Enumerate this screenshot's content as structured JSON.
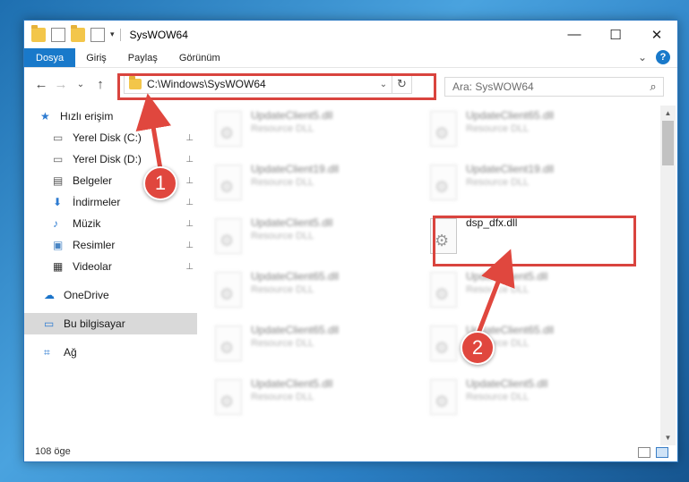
{
  "window": {
    "title": "SysWOW64",
    "minimize_glyph": "—",
    "maximize_glyph": "☐",
    "close_glyph": "✕"
  },
  "ribbon": {
    "tabs": [
      "Dosya",
      "Giriş",
      "Paylaş",
      "Görünüm"
    ],
    "collapse_glyph": "⌄",
    "help_glyph": "?"
  },
  "nav": {
    "back_glyph": "←",
    "forward_glyph": "→",
    "recent_glyph": "⌄",
    "up_glyph": "↑",
    "address": "C:\\Windows\\SysWOW64",
    "address_dropdown_glyph": "⌄",
    "refresh_glyph": "↻",
    "search_placeholder": "Ara: SysWOW64",
    "search_glyph": "⌕"
  },
  "sidebar": {
    "items": [
      {
        "label": "Hızlı erişim",
        "icon": "star-icon"
      },
      {
        "label": "Yerel Disk (C:)",
        "icon": "drive-icon",
        "pinned": true
      },
      {
        "label": "Yerel Disk (D:)",
        "icon": "drive-icon",
        "pinned": true
      },
      {
        "label": "Belgeler",
        "icon": "document-icon",
        "pinned": true
      },
      {
        "label": "İndirmeler",
        "icon": "download-icon",
        "pinned": true
      },
      {
        "label": "Müzik",
        "icon": "music-icon",
        "pinned": true
      },
      {
        "label": "Resimler",
        "icon": "pictures-icon",
        "pinned": true
      },
      {
        "label": "Videolar",
        "icon": "video-icon",
        "pinned": true
      },
      {
        "label": "OneDrive",
        "icon": "cloud-icon"
      },
      {
        "label": "Bu bilgisayar",
        "icon": "computer-icon",
        "selected": true
      },
      {
        "label": "Ağ",
        "icon": "network-icon"
      }
    ],
    "pin_glyph": "📌"
  },
  "files": [
    {
      "name": "UpdateClient5.dll",
      "type": "Resource DLL",
      "blurred": true
    },
    {
      "name": "UpdateClient65.dll",
      "type": "Resource DLL",
      "blurred": true
    },
    {
      "name": "UpdateClient19.dll",
      "type": "Resource DLL",
      "blurred": true
    },
    {
      "name": "UpdateClient19.dll",
      "type": "Resource DLL",
      "blurred": true
    },
    {
      "name": "UpdateClient5.dll",
      "type": "Resource DLL",
      "blurred": true
    },
    {
      "name": "dsp_dfx.dll",
      "type": "",
      "blurred": false
    },
    {
      "name": "UpdateClient65.dll",
      "type": "Resource DLL",
      "blurred": true
    },
    {
      "name": "UpdateClient5.dll",
      "type": "Resource DLL",
      "blurred": true
    },
    {
      "name": "UpdateClient65.dll",
      "type": "Resource DLL",
      "blurred": true
    },
    {
      "name": "UpdateClient65.dll",
      "type": "Resource DLL",
      "blurred": true
    },
    {
      "name": "UpdateClient5.dll",
      "type": "Resource DLL",
      "blurred": true
    },
    {
      "name": "UpdateClient5.dll",
      "type": "Resource DLL",
      "blurred": true
    }
  ],
  "status": {
    "item_count": "108 öge"
  },
  "callouts": {
    "one": "1",
    "two": "2"
  },
  "colors": {
    "accent": "#1979ca",
    "highlight": "#d9443e"
  }
}
